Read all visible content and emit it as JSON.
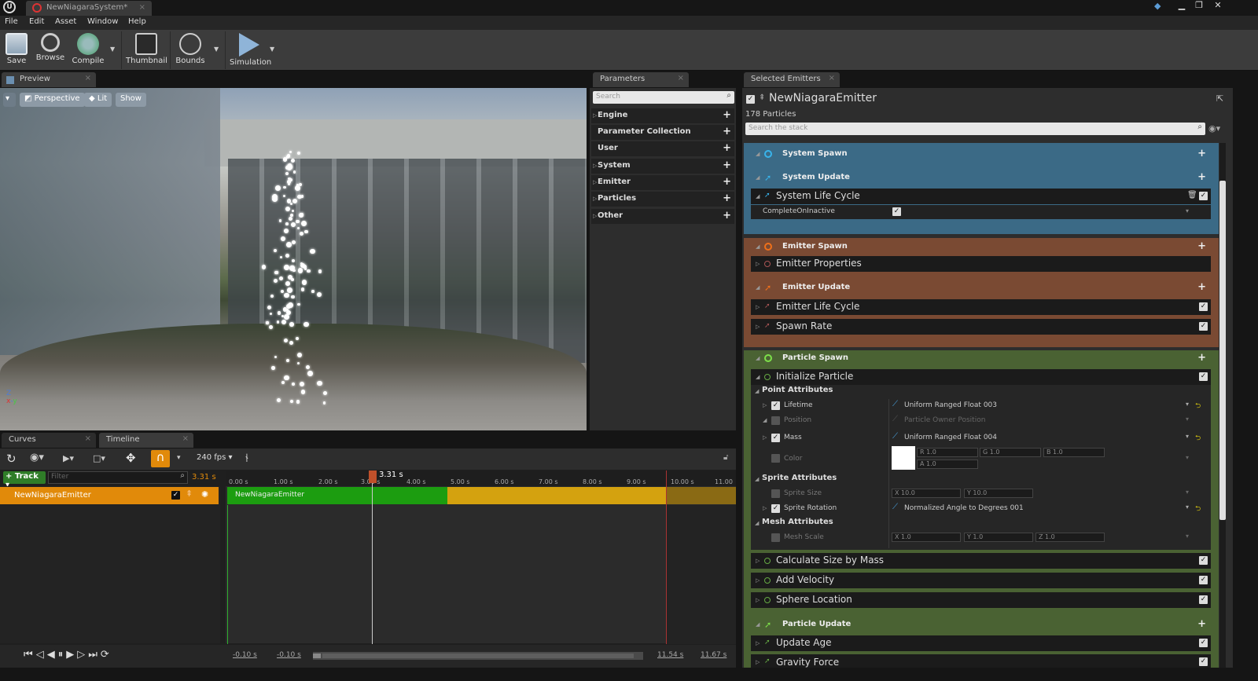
{
  "app": {
    "tab_title": "NewNiagaraSystem*",
    "logo": "U"
  },
  "menu": [
    "File",
    "Edit",
    "Asset",
    "Window",
    "Help"
  ],
  "toolbar": {
    "save": "Save",
    "browse": "Browse",
    "compile": "Compile",
    "thumbnail": "Thumbnail",
    "bounds": "Bounds",
    "simulation": "Simulation"
  },
  "preview": {
    "tab": "Preview",
    "perspective": "Perspective",
    "lit": "Lit",
    "show": "Show"
  },
  "parameters": {
    "tab": "Parameters",
    "search_placeholder": "Search",
    "items": [
      "Engine",
      "Parameter Collection",
      "User",
      "System",
      "Emitter",
      "Particles",
      "Other"
    ]
  },
  "selected_emitters": {
    "tab": "Selected Emitters",
    "emitter_name": "NewNiagaraEmitter",
    "particle_count": "178 Particles",
    "search_placeholder": "Search the stack",
    "system_spawn": "System Spawn",
    "system_update": "System Update",
    "system_life_cycle": "System Life Cycle",
    "complete_on_inactive": "CompleteOnInactive",
    "emitter_spawn": "Emitter Spawn",
    "emitter_properties": "Emitter Properties",
    "emitter_update": "Emitter Update",
    "emitter_life_cycle": "Emitter Life Cycle",
    "spawn_rate": "Spawn Rate",
    "particle_spawn": "Particle Spawn",
    "initialize_particle": "Initialize Particle",
    "point_attributes": "Point Attributes",
    "lifetime": "Lifetime",
    "lifetime_value": "Uniform Ranged Float 003",
    "position": "Position",
    "position_value": "Particle Owner Position",
    "mass": "Mass",
    "mass_value": "Uniform Ranged Float 004",
    "color": "Color",
    "color_r": "R 1.0",
    "color_g": "G 1.0",
    "color_b": "B 1.0",
    "color_a": "A 1.0",
    "sprite_attributes": "Sprite Attributes",
    "sprite_size": "Sprite Size",
    "sprite_size_x": "X 10.0",
    "sprite_size_y": "Y 10.0",
    "sprite_rotation": "Sprite Rotation",
    "sprite_rotation_value": "Normalized Angle to Degrees 001",
    "mesh_attributes": "Mesh Attributes",
    "mesh_scale": "Mesh Scale",
    "mesh_x": "X 1.0",
    "mesh_y": "Y 1.0",
    "mesh_z": "Z 1.0",
    "calc_size": "Calculate Size by Mass",
    "add_velocity": "Add Velocity",
    "sphere_location": "Sphere Location",
    "particle_update": "Particle Update",
    "update_age": "Update Age",
    "gravity_force": "Gravity Force"
  },
  "timeline": {
    "curves_tab": "Curves",
    "timeline_tab": "Timeline",
    "fps": "240 fps",
    "track_btn": "Track",
    "filter_placeholder": "Filter",
    "current_time": "3.31 s",
    "current_time_short": "3.31 s",
    "emitter_track": "NewNiagaraEmitter",
    "clip_label": "NewNiagaraEmitter",
    "ticks": [
      "0.00 s",
      "1.00 s",
      "2.00 s",
      "3.00 s",
      "4.00 s",
      "5.00 s",
      "6.00 s",
      "7.00 s",
      "8.00 s",
      "9.00 s",
      "10.00 s",
      "11.00"
    ],
    "range_start_a": "-0.10 s",
    "range_start_b": "-0.10 s",
    "range_end_a": "11.54 s",
    "range_end_b": "11.67 s"
  },
  "colors": {
    "system_blue": "#3b6a86",
    "emitter_brown": "#7a4a33",
    "particle_green": "#4a6233",
    "timeline_green": "#1c9d10",
    "timeline_orange": "#d4a20f",
    "track_orange": "#e18a0a"
  }
}
